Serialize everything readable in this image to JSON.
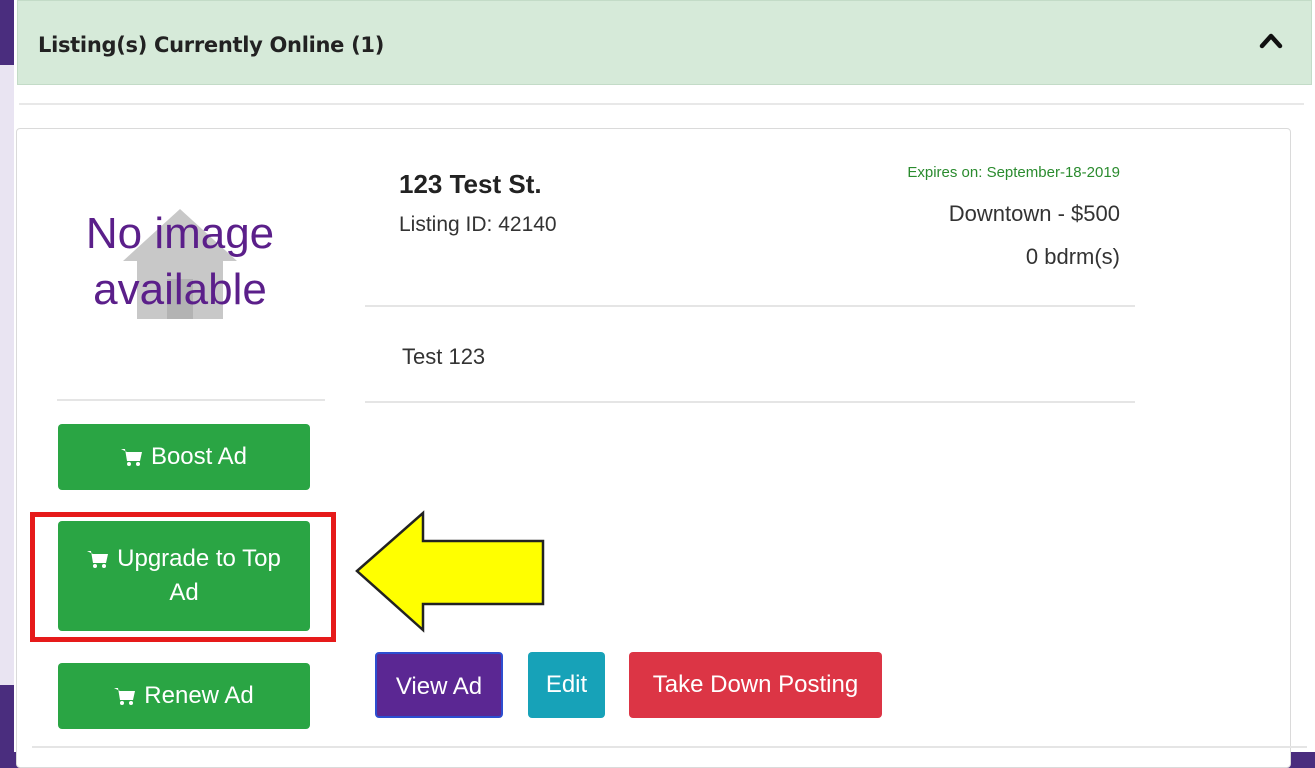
{
  "panel": {
    "title": "Listing(s) Currently Online (1)",
    "collapse_icon": "chevron-up-icon"
  },
  "listing": {
    "image_placeholder": [
      "No image",
      "available"
    ],
    "title": "123 Test St.",
    "listing_id": "Listing ID: 42140",
    "expires": "Expires on: September-18-2019",
    "location_price": "Downtown - $500",
    "bedrooms": "0 bdrm(s)",
    "description": "Test 123"
  },
  "actions": {
    "boost": "Boost Ad",
    "upgrade_line1": "Upgrade to Top",
    "upgrade_line2": "Ad",
    "renew": "Renew Ad",
    "view": "View Ad",
    "edit": "Edit",
    "take_down": "Take Down Posting",
    "cart_icon": "shopping-cart-icon"
  },
  "colors": {
    "header_bg": "#d6ead9",
    "success_green": "#2aa544",
    "view_purple": "#5b2793",
    "edit_teal": "#17a2b8",
    "danger_red": "#dc3545",
    "highlight_red": "#e61a1a",
    "arrow_yellow": "#ffff00",
    "placeholder_purple": "#5b1f8a"
  }
}
